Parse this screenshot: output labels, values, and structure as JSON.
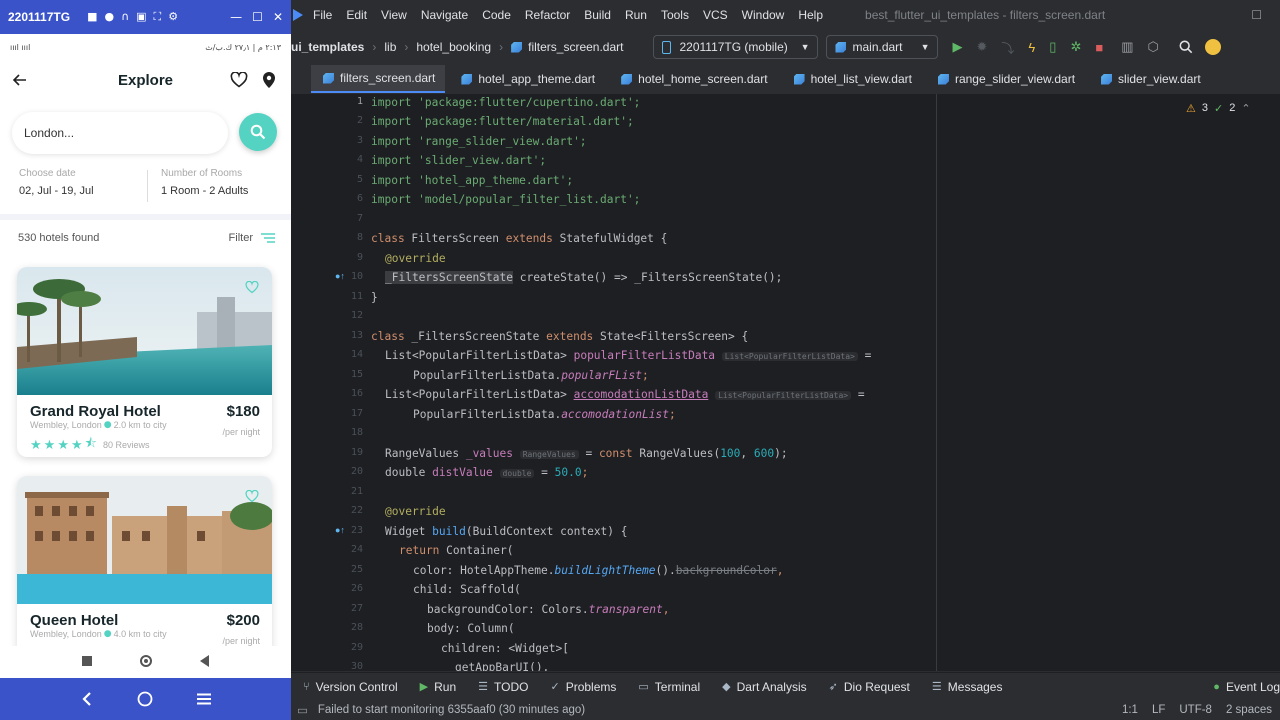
{
  "phone": {
    "mirror_title": "2201117TG",
    "status_left": "٢:١٣ م | ٢٧٫١ ك.ب/ث ",
    "status_right": "ıııl ıııl",
    "app_title": "Explore",
    "search": {
      "value": "London..."
    },
    "choose_date_label": "Choose date",
    "choose_date_value": "02, Jul - 19, Jul",
    "rooms_label": "Number of Rooms",
    "rooms_value": "1 Room - 2 Adults",
    "hotels_found": "530 hotels found",
    "filter_label": "Filter",
    "hotels": [
      {
        "name": "Grand Royal Hotel",
        "price": "$180",
        "location": "Wembley, London",
        "distance": "2.0 km to city",
        "per_night": "/per night",
        "reviews": "80 Reviews",
        "rating": 4.5
      },
      {
        "name": "Queen Hotel",
        "price": "$200",
        "location": "Wembley, London",
        "distance": "4.0 km to city",
        "per_night": "/per night"
      }
    ]
  },
  "ide": {
    "menu": [
      "File",
      "Edit",
      "View",
      "Navigate",
      "Code",
      "Refactor",
      "Build",
      "Run",
      "Tools",
      "VCS",
      "Window",
      "Help"
    ],
    "window_title": "best_flutter_ui_templates - filters_screen.dart",
    "breadcrumbs": [
      "ui_templates",
      "lib",
      "hotel_booking",
      "filters_screen.dart"
    ],
    "device": "2201117TG (mobile)",
    "run_config": "main.dart",
    "tabs": [
      "filters_screen.dart",
      "hotel_app_theme.dart",
      "hotel_home_screen.dart",
      "hotel_list_view.dart",
      "range_slider_view.dart",
      "slider_view.dart"
    ],
    "warnings": {
      "warn_count": "3",
      "ok_count": "2"
    },
    "line_numbers": [
      "1",
      "2",
      "3",
      "4",
      "5",
      "6",
      "7",
      "8",
      "9",
      "10",
      "11",
      "12",
      "13",
      "14",
      "15",
      "16",
      "17",
      "18",
      "19",
      "20",
      "21",
      "22",
      "23",
      "24",
      "25",
      "26",
      "27",
      "28",
      "29",
      "30"
    ],
    "code": {
      "l1": "import 'package:flutter/cupertino.dart';",
      "l2": "import 'package:flutter/material.dart';",
      "l3": "import 'range_slider_view.dart';",
      "l4": "import 'slider_view.dart';",
      "l5": "import 'hotel_app_theme.dart';",
      "l6": "import 'model/popular_filter_list.dart';",
      "l8a": "class ",
      "l8b": "FiltersScreen ",
      "l8c": "extends ",
      "l8d": "StatefulWidget {",
      "l9": "@override",
      "l10a": "_FiltersScreenState",
      "l10b": " createState() => _FiltersScreenState();",
      "l11": "}",
      "l13a": "class ",
      "l13b": "_FiltersScreenState ",
      "l13c": "extends ",
      "l13d": "State<FiltersScreen> {",
      "l14a": "List<PopularFilterListData> ",
      "l14b": "popularFilterListData",
      "l14c": "List<PopularFilterListData>",
      "l14d": " =",
      "l15a": "PopularFilterListData.",
      "l15b": "popularFList",
      "l15c": ";",
      "l16a": "List<PopularFilterListData> ",
      "l16b": "accomodationListData",
      "l16c": "List<PopularFilterListData>",
      "l16d": " =",
      "l17a": "PopularFilterListData.",
      "l17b": "accomodationList",
      "l17c": ";",
      "l19a": "RangeValues ",
      "l19b": "_values",
      "l19c": "RangeValues",
      "l19d": " = ",
      "l19e": "const ",
      "l19f": "RangeValues(",
      "l19g": "100",
      "l19h": ", ",
      "l19i": "600",
      "l19j": ");",
      "l20a": "double ",
      "l20b": "distValue",
      "l20c": "double",
      "l20d": " = ",
      "l20e": "50.0",
      "l20f": ";",
      "l22": "@override",
      "l23a": "Widget ",
      "l23b": "build",
      "l23c": "(BuildContext context) {",
      "l24a": "return ",
      "l24b": "Container(",
      "l25a": "color: HotelAppTheme.",
      "l25b": "buildLightTheme",
      "l25c": "().",
      "l25d": "backgroundColor",
      "l25e": ",",
      "l26a": "child: ",
      "l26b": "Scaffold(",
      "l27a": "backgroundColor: Colors.",
      "l27b": "transparent",
      "l27c": ",",
      "l28a": "body: ",
      "l28b": "Column(",
      "l29": "children: <Widget>[",
      "l30": "getAppBarUI(),"
    },
    "toolwindows": [
      "Version Control",
      "Run",
      "TODO",
      "Problems",
      "Terminal",
      "Dart Analysis",
      "Dio Request",
      "Messages",
      "Event Log"
    ],
    "status_message": "Failed to start monitoring 6355aaf0 (30 minutes ago)",
    "status_right": [
      "1:1",
      "LF",
      "UTF-8",
      "2 spaces"
    ]
  }
}
